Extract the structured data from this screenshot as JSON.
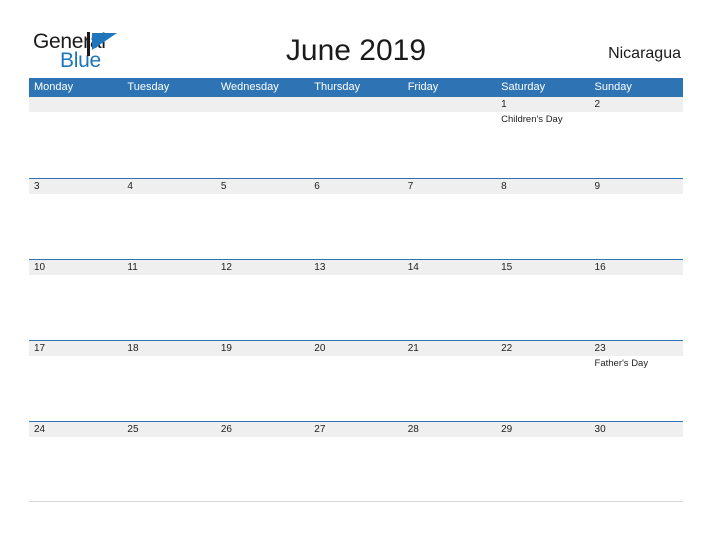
{
  "brand": {
    "name_part1": "General",
    "name_part2": "Blue",
    "mark": "blue-flag-triangle",
    "accent_color": "#1f76bd"
  },
  "header": {
    "title": "June 2019",
    "region": "Nicaragua"
  },
  "theme": {
    "header_blue": "#2e74b5",
    "band_gray": "#efefef",
    "text": "#222222",
    "page_background": "#ffffff"
  },
  "calendar": {
    "weekdays": [
      "Monday",
      "Tuesday",
      "Wednesday",
      "Thursday",
      "Friday",
      "Saturday",
      "Sunday"
    ],
    "weeks": [
      [
        {
          "date": "",
          "event": ""
        },
        {
          "date": "",
          "event": ""
        },
        {
          "date": "",
          "event": ""
        },
        {
          "date": "",
          "event": ""
        },
        {
          "date": "",
          "event": ""
        },
        {
          "date": "1",
          "event": "Children's Day"
        },
        {
          "date": "2",
          "event": ""
        }
      ],
      [
        {
          "date": "3",
          "event": ""
        },
        {
          "date": "4",
          "event": ""
        },
        {
          "date": "5",
          "event": ""
        },
        {
          "date": "6",
          "event": ""
        },
        {
          "date": "7",
          "event": ""
        },
        {
          "date": "8",
          "event": ""
        },
        {
          "date": "9",
          "event": ""
        }
      ],
      [
        {
          "date": "10",
          "event": ""
        },
        {
          "date": "11",
          "event": ""
        },
        {
          "date": "12",
          "event": ""
        },
        {
          "date": "13",
          "event": ""
        },
        {
          "date": "14",
          "event": ""
        },
        {
          "date": "15",
          "event": ""
        },
        {
          "date": "16",
          "event": ""
        }
      ],
      [
        {
          "date": "17",
          "event": ""
        },
        {
          "date": "18",
          "event": ""
        },
        {
          "date": "19",
          "event": ""
        },
        {
          "date": "20",
          "event": ""
        },
        {
          "date": "21",
          "event": ""
        },
        {
          "date": "22",
          "event": ""
        },
        {
          "date": "23",
          "event": "Father's Day"
        }
      ],
      [
        {
          "date": "24",
          "event": ""
        },
        {
          "date": "25",
          "event": ""
        },
        {
          "date": "26",
          "event": ""
        },
        {
          "date": "27",
          "event": ""
        },
        {
          "date": "28",
          "event": ""
        },
        {
          "date": "29",
          "event": ""
        },
        {
          "date": "30",
          "event": ""
        }
      ]
    ]
  }
}
